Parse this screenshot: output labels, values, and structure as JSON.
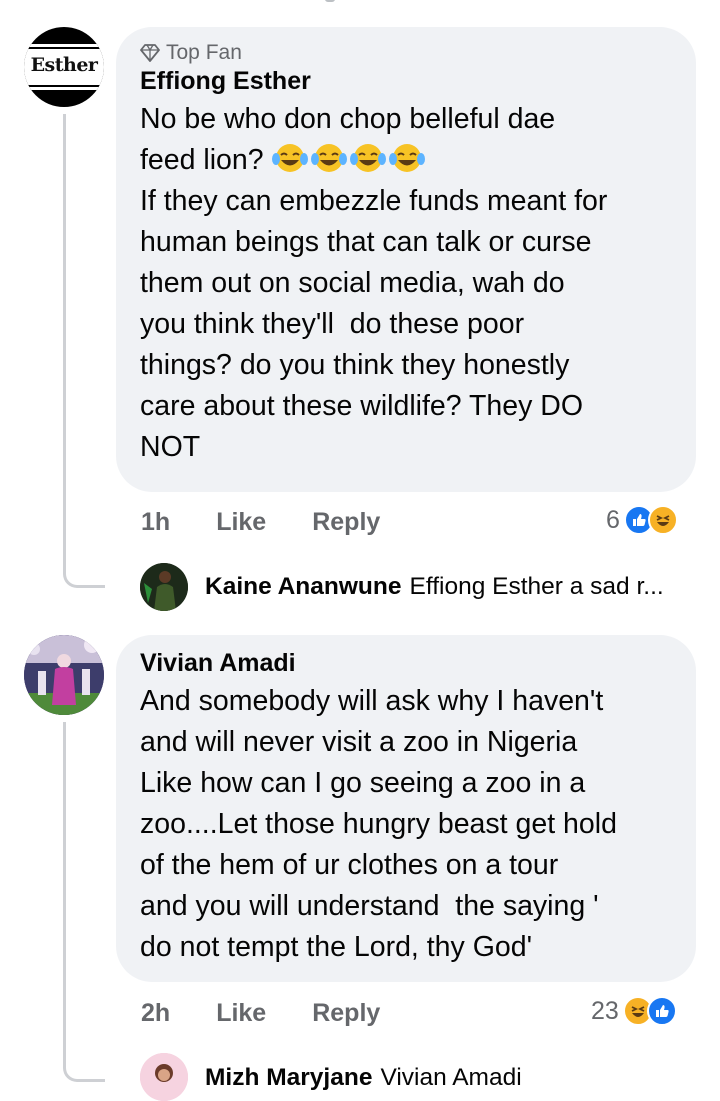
{
  "comments": [
    {
      "badge": "Top Fan",
      "author": "Effiong Esther",
      "avatar_text": "Esther",
      "text_line1": "No be who don chop belleful dae",
      "text_line2": "feed lion?",
      "text_rest": "If they can embezzle funds meant for\nhuman beings that can talk or curse\nthem out on social media, wah do\nyou think they'll  do these poor\nthings? do you think they honestly\ncare about these wildlife? They DO\nNOT",
      "time": "1h",
      "like_label": "Like",
      "reply_label": "Reply",
      "reaction_count": "6",
      "reactions": [
        "like-icon",
        "haha-icon"
      ],
      "reply": {
        "author": "Kaine Ananwune",
        "preview": "Effiong Esther a sad r..."
      }
    },
    {
      "author": "Vivian Amadi",
      "text": "And somebody will ask why I haven't\nand will never visit a zoo in Nigeria\nLike how can I go seeing a zoo in a\nzoo....Let those hungry beast get hold\nof the hem of ur clothes on a tour\nand you will understand  the saying '\ndo not tempt the Lord, thy God'",
      "time": "2h",
      "like_label": "Like",
      "reply_label": "Reply",
      "reaction_count": "23",
      "reactions": [
        "haha-icon",
        "like-icon"
      ],
      "reply": {
        "author": "Mizh Maryjane",
        "preview": "Vivian Amadi"
      }
    }
  ],
  "colors": {
    "bubble": "#f0f2f5",
    "secondary_text": "#65676b",
    "like_blue": "#1877f2",
    "haha_yellow": "#f7b125",
    "thread_line": "#ced0d4"
  }
}
